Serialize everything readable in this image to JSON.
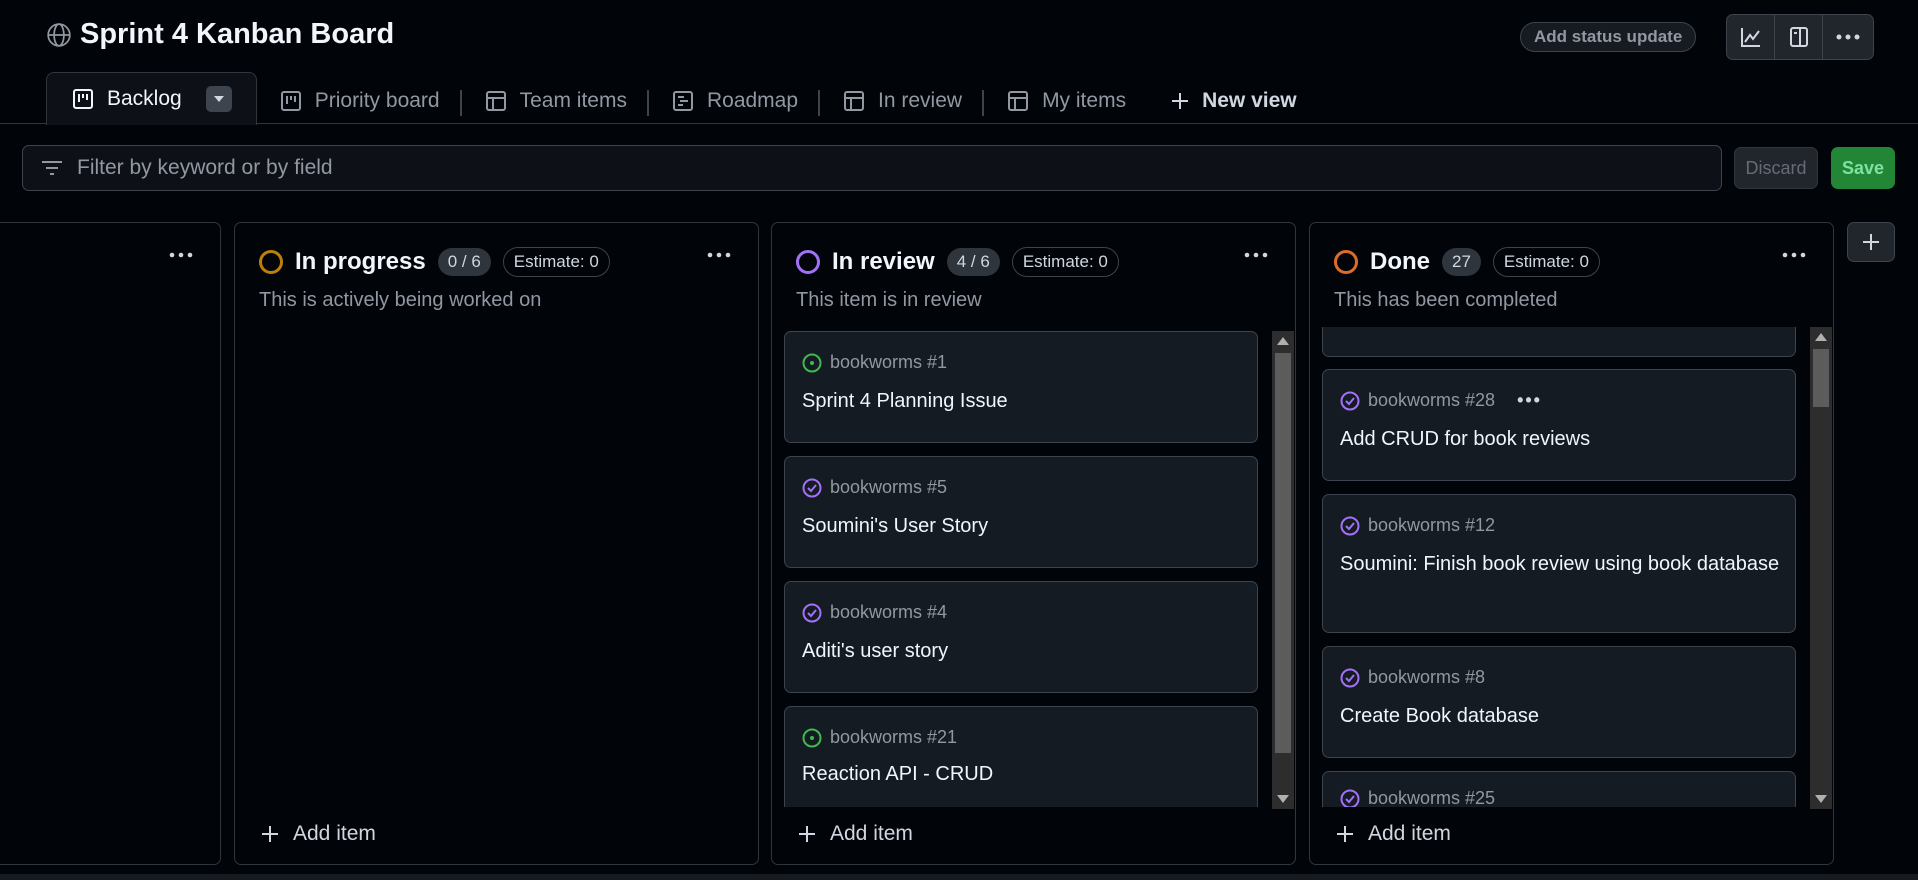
{
  "header": {
    "title": "Sprint 4 Kanban Board",
    "status_button": "Add status update"
  },
  "tabs": [
    {
      "label": "Backlog",
      "icon": "board-icon",
      "active": true
    },
    {
      "label": "Priority board",
      "icon": "board-icon"
    },
    {
      "label": "Team items",
      "icon": "table-icon"
    },
    {
      "label": "Roadmap",
      "icon": "roadmap-icon"
    },
    {
      "label": "In review",
      "icon": "table-icon"
    },
    {
      "label": "My items",
      "icon": "table-icon"
    },
    {
      "label": "New view",
      "icon": "plus-icon"
    }
  ],
  "filter": {
    "placeholder": "Filter by keyword or by field"
  },
  "actions": {
    "discard": "Discard",
    "save": "Save"
  },
  "columns": {
    "in_progress": {
      "name": "In progress",
      "count": "0 / 6",
      "estimate": "Estimate: 0",
      "description": "This is actively being worked on",
      "add_item": "Add item",
      "color": "#bb8009"
    },
    "in_review": {
      "name": "In review",
      "count": "4 / 6",
      "estimate": "Estimate: 0",
      "description": "This item is in review",
      "add_item": "Add item",
      "color": "#a371f7",
      "cards": [
        {
          "ref": "bookworms #1",
          "title": "Sprint 4 Planning Issue",
          "status": "open"
        },
        {
          "ref": "bookworms #5",
          "title": "Soumini's User Story",
          "status": "closed"
        },
        {
          "ref": "bookworms #4",
          "title": "Aditi's user story",
          "status": "closed"
        },
        {
          "ref": "bookworms #21",
          "title": "Reaction API - CRUD",
          "status": "open"
        }
      ]
    },
    "done": {
      "name": "Done",
      "count": "27",
      "estimate": "Estimate: 0",
      "description": "This has been completed",
      "add_item": "Add item",
      "color": "#db6d28",
      "cards": [
        {
          "ref": "bookworms #28",
          "title": "Add CRUD for book reviews",
          "status": "closed"
        },
        {
          "ref": "bookworms #12",
          "title": "Soumini: Finish book review using book database",
          "status": "closed"
        },
        {
          "ref": "bookworms #8",
          "title": "Create Book database",
          "status": "closed"
        },
        {
          "ref": "bookworms #25",
          "title": "",
          "status": "closed"
        }
      ]
    }
  },
  "colors": {
    "open": "#3fb950",
    "closed": "#a371f7",
    "save": "#238636"
  }
}
